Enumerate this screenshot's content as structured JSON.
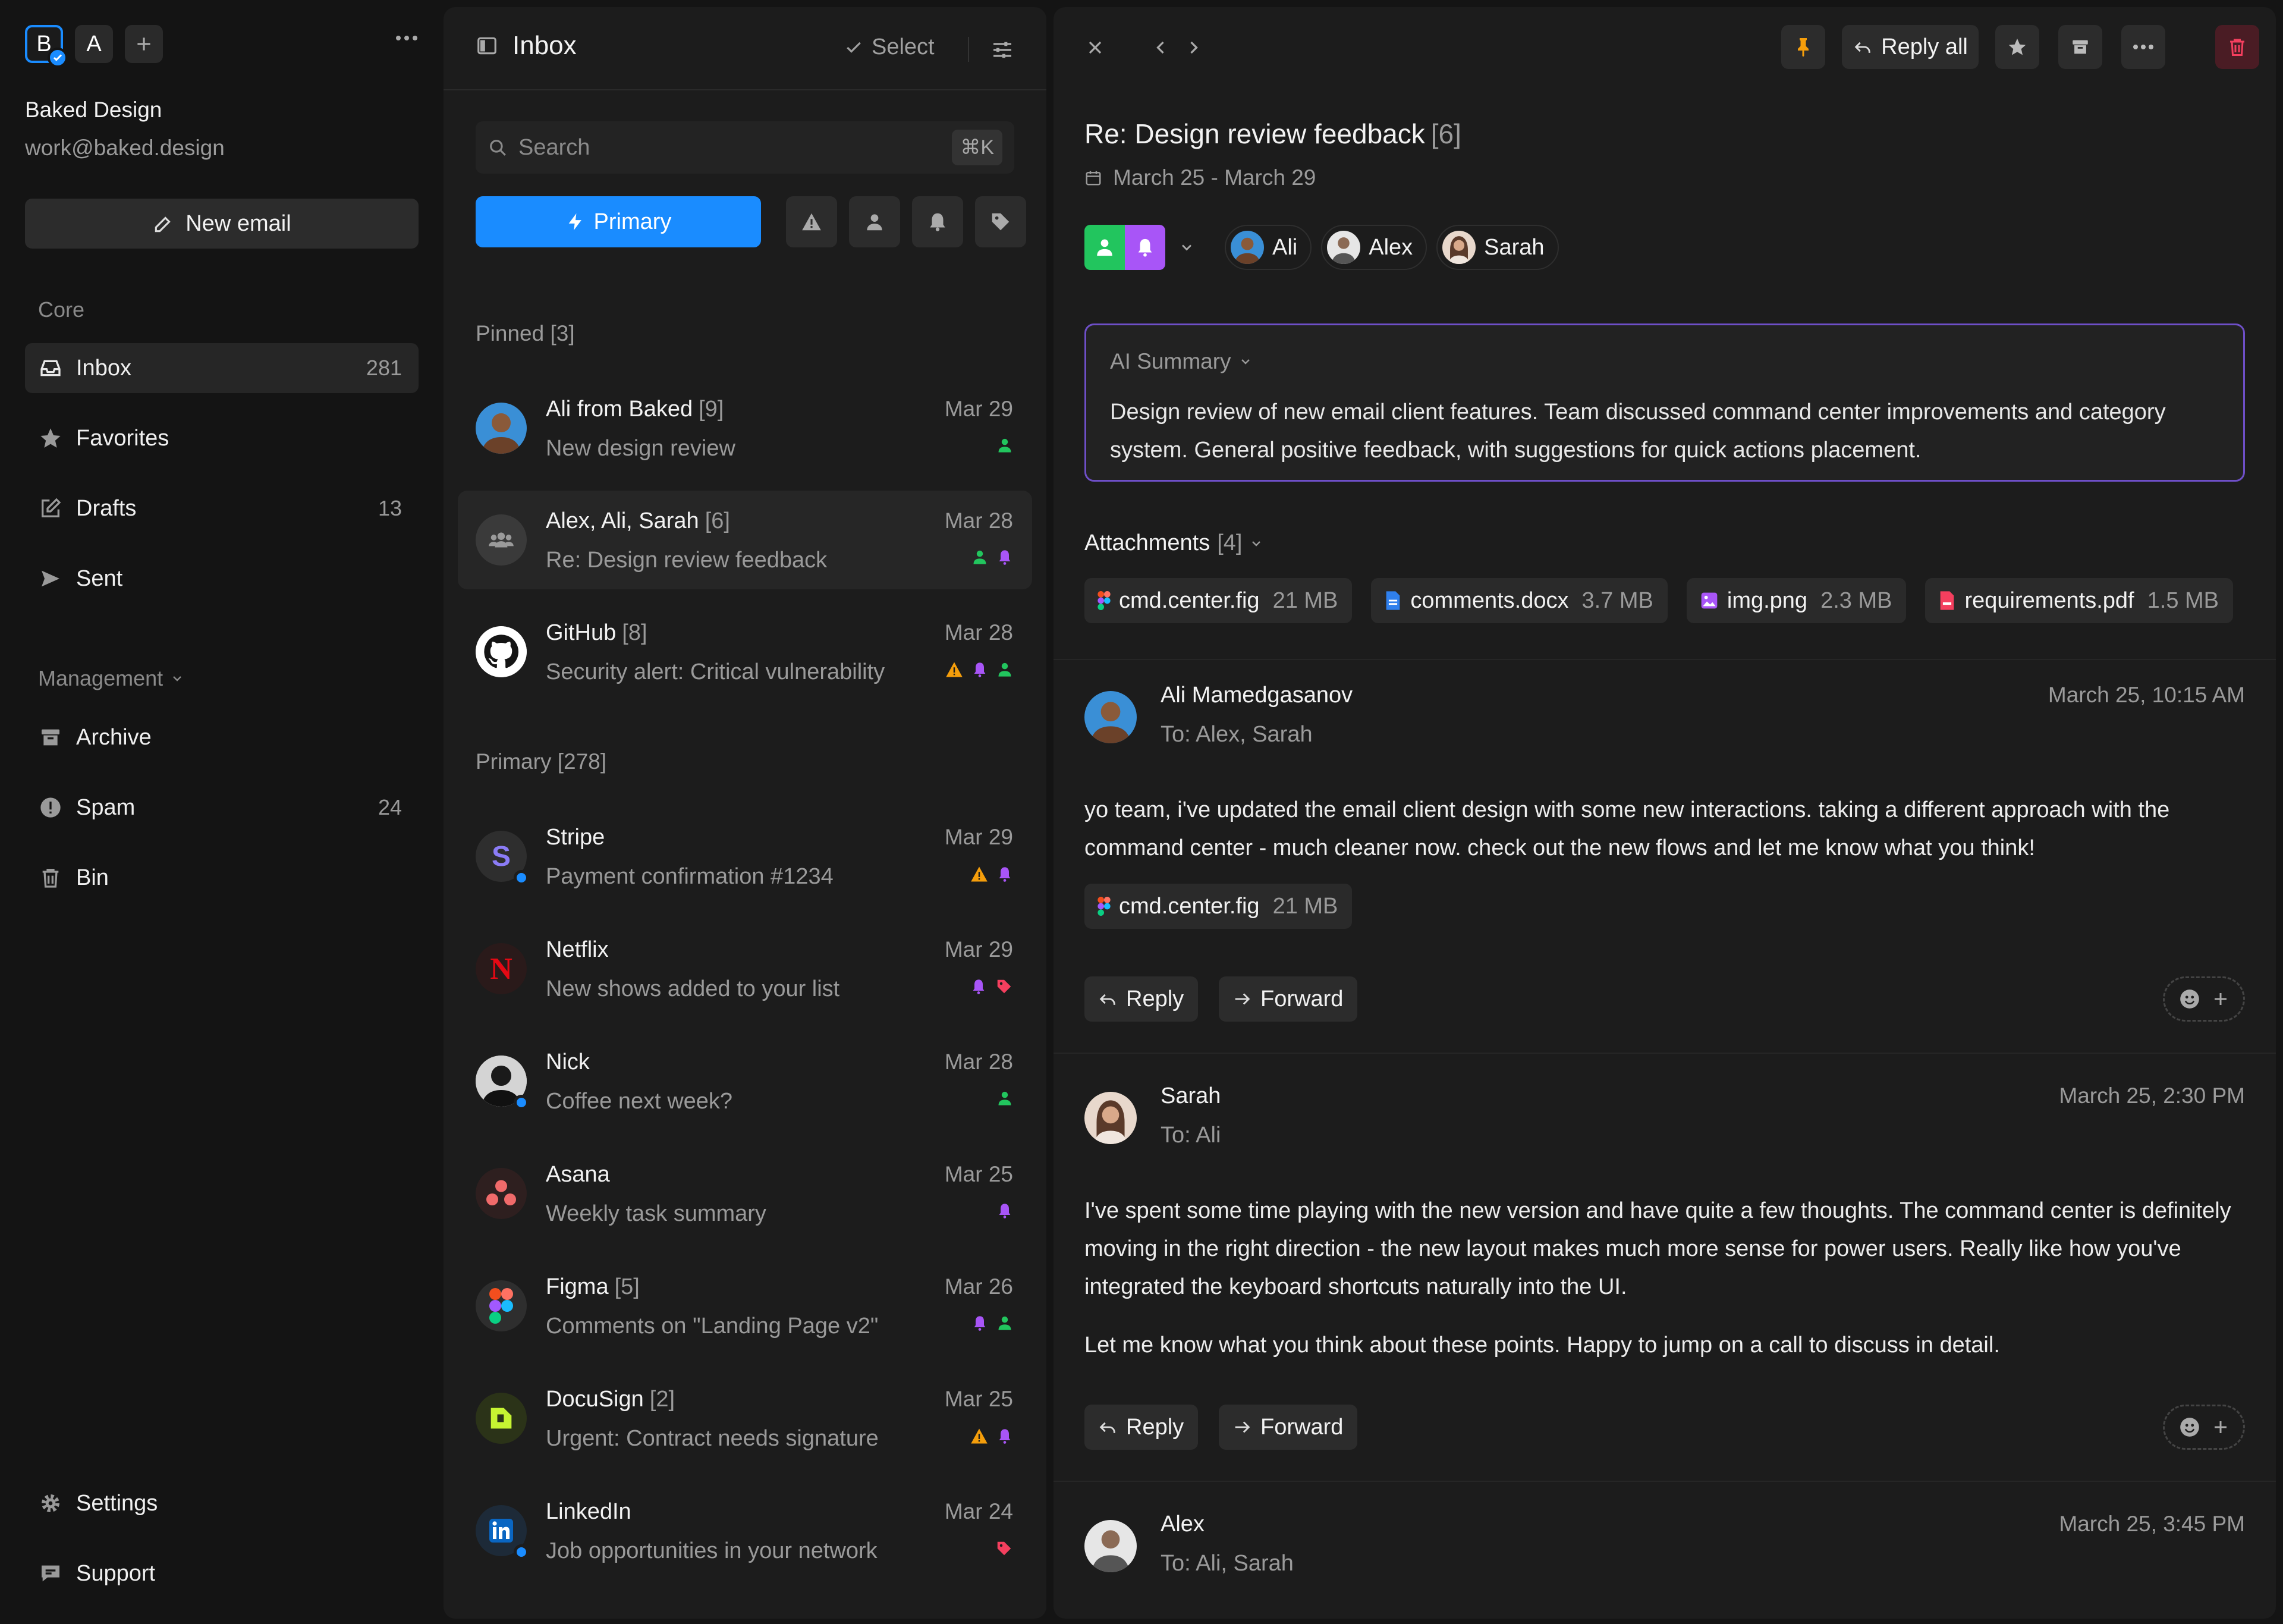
{
  "sidebar": {
    "accounts": [
      "B",
      "A"
    ],
    "account_name": "Baked Design",
    "account_email": "work@baked.design",
    "new_email": "New email",
    "core_label": "Core",
    "management_label": "Management",
    "core_items": [
      {
        "label": "Inbox",
        "count": "281",
        "icon": "inbox-icon"
      },
      {
        "label": "Favorites",
        "count": "",
        "icon": "star-icon"
      },
      {
        "label": "Drafts",
        "count": "13",
        "icon": "edit-icon"
      },
      {
        "label": "Sent",
        "count": "",
        "icon": "send-icon"
      }
    ],
    "management_items": [
      {
        "label": "Archive",
        "count": "",
        "icon": "archive-icon"
      },
      {
        "label": "Spam",
        "count": "24",
        "icon": "spam-icon"
      },
      {
        "label": "Bin",
        "count": "",
        "icon": "trash-icon"
      }
    ],
    "settings": "Settings",
    "support": "Support"
  },
  "list": {
    "title": "Inbox",
    "select": "Select",
    "search_placeholder": "Search",
    "search_shortcut": "⌘K",
    "primary_tab": "Primary",
    "pinned_label": "Pinned",
    "pinned_count": "[3]",
    "primary_label": "Primary",
    "primary_count": "[278]",
    "pinned": [
      {
        "sender": "Ali from Baked",
        "count": "[9]",
        "subject": "New design review",
        "date": "Mar 29"
      },
      {
        "sender": "Alex, Ali, Sarah",
        "count": "[6]",
        "subject": "Re: Design review feedback",
        "date": "Mar 28"
      },
      {
        "sender": "GitHub",
        "count": "[8]",
        "subject": "Security alert: Critical vulnerability",
        "date": "Mar 28"
      }
    ],
    "primary": [
      {
        "sender": "Stripe",
        "count": "",
        "subject": "Payment confirmation #1234",
        "date": "Mar 29"
      },
      {
        "sender": "Netflix",
        "count": "",
        "subject": "New shows added to your list",
        "date": "Mar 29"
      },
      {
        "sender": "Nick",
        "count": "",
        "subject": "Coffee next week?",
        "date": "Mar 28"
      },
      {
        "sender": "Asana",
        "count": "",
        "subject": "Weekly task summary",
        "date": "Mar 25"
      },
      {
        "sender": "Figma",
        "count": "[5]",
        "subject": "Comments on \"Landing Page v2\"",
        "date": "Mar 26"
      },
      {
        "sender": "DocuSign",
        "count": "[2]",
        "subject": "Urgent: Contract needs signature",
        "date": "Mar 25"
      },
      {
        "sender": "LinkedIn",
        "count": "",
        "subject": "Job opportunities in your network",
        "date": "Mar 24"
      }
    ]
  },
  "reader": {
    "reply_all": "Reply all",
    "title": "Re: Design review feedback",
    "title_count": "[6]",
    "date_range": "March 25 - March 29",
    "participants": [
      "Ali",
      "Alex",
      "Sarah"
    ],
    "ai_summary_label": "AI Summary",
    "ai_summary_text": "Design review of new email client features. Team discussed command center improvements and category system. General positive feedback, with suggestions for quick actions placement.",
    "attachments_label": "Attachments",
    "attachments_count": "[4]",
    "attachments": [
      {
        "name": "cmd.center.fig",
        "size": "21 MB"
      },
      {
        "name": "comments.docx",
        "size": "3.7 MB"
      },
      {
        "name": "img.png",
        "size": "2.3 MB"
      },
      {
        "name": "requirements.pdf",
        "size": "1.5 MB"
      }
    ],
    "reply": "Reply",
    "forward": "Forward",
    "messages": [
      {
        "from": "Ali Mamedgasanov",
        "to": "To: Alex, Sarah",
        "time": "March 25, 10:15 AM",
        "body": [
          "yo team, i've updated the email client design with some new interactions. taking a different approach with the command center - much cleaner now. check out the new flows and let me know what you think!"
        ],
        "attachment": {
          "name": "cmd.center.fig",
          "size": "21 MB"
        }
      },
      {
        "from": "Sarah",
        "to": "To: Ali",
        "time": "March 25, 2:30 PM",
        "body": [
          "I've spent some time playing with the new version and have quite a few thoughts. The command center is definitely moving in the right direction - the new layout makes much more sense for power users. Really like how you've integrated the keyboard shortcuts naturally into the UI.",
          "Let me know what you think about these points. Happy to jump on a call to discuss in detail."
        ]
      },
      {
        "from": "Alex",
        "to": "To: Ali, Sarah",
        "time": "March 25, 3:45 PM",
        "body": []
      }
    ]
  },
  "colors": {
    "accent": "#1a8cff",
    "green": "#22c55e",
    "purple": "#a855f7",
    "orange": "#f59e0b",
    "red": "#f43f5e",
    "ai_border": "#6e4fc7"
  }
}
